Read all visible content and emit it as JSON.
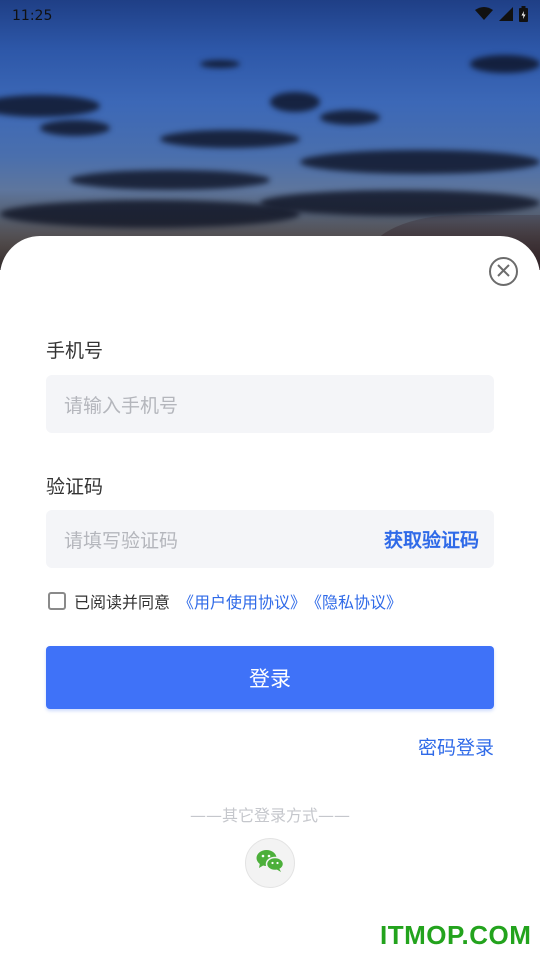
{
  "status_bar": {
    "time": "11:25"
  },
  "form": {
    "phone_label": "手机号",
    "phone_placeholder": "请输入手机号",
    "code_label": "验证码",
    "code_placeholder": "请填写验证码",
    "get_code_label": "获取验证码",
    "agreement_prefix": "已阅读并同意",
    "user_agreement_link": "《用户使用协议》",
    "privacy_link": "《隐私协议》",
    "agree_checked": false,
    "login_label": "登录",
    "password_login_label": "密码登录"
  },
  "other_login": {
    "title": "——其它登录方式——",
    "methods": [
      {
        "icon": "wechat-icon"
      }
    ]
  },
  "watermark": {
    "text": "ITMOP.COM"
  },
  "colors": {
    "accent": "#3f72f8",
    "link": "#2f6ae8",
    "input_bg": "#f4f5f8",
    "watermark": "#23a31d"
  }
}
